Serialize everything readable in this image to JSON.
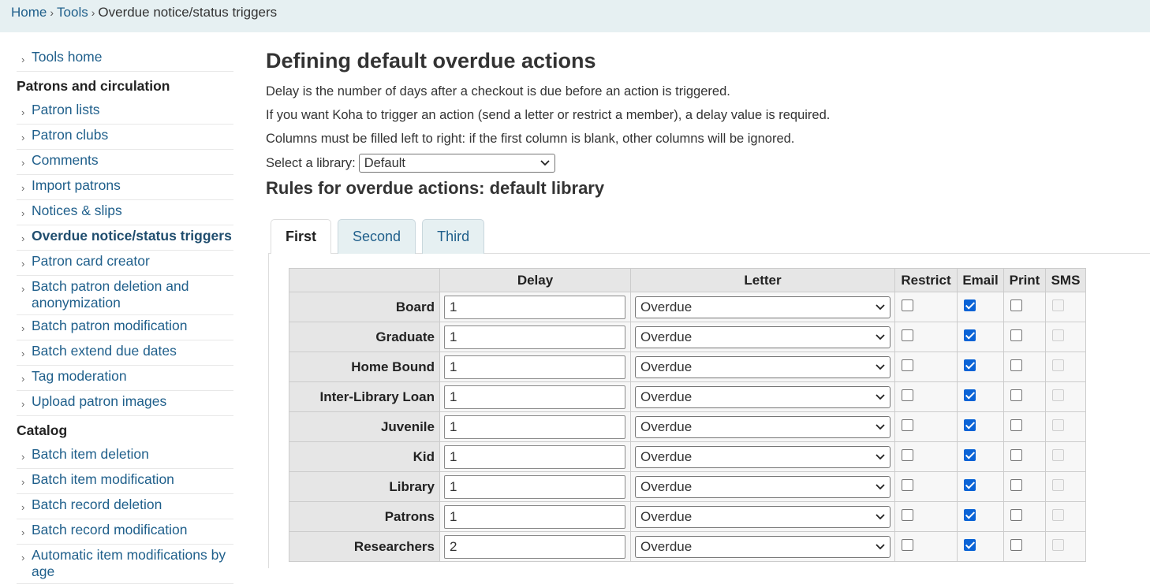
{
  "breadcrumb": {
    "home": "Home",
    "tools": "Tools",
    "current": "Overdue notice/status triggers",
    "sep": "›"
  },
  "sidebar": {
    "tools_home": "Tools home",
    "section1": "Patrons and circulation",
    "items1": [
      {
        "label": "Patron lists",
        "current": false
      },
      {
        "label": "Patron clubs",
        "current": false
      },
      {
        "label": "Comments",
        "current": false
      },
      {
        "label": "Import patrons",
        "current": false
      },
      {
        "label": "Notices & slips",
        "current": false
      },
      {
        "label": "Overdue notice/status triggers",
        "current": true
      },
      {
        "label": "Patron card creator",
        "current": false
      },
      {
        "label": "Batch patron deletion and anonymization",
        "current": false
      },
      {
        "label": "Batch patron modification",
        "current": false
      },
      {
        "label": "Batch extend due dates",
        "current": false
      },
      {
        "label": "Tag moderation",
        "current": false
      },
      {
        "label": "Upload patron images",
        "current": false
      }
    ],
    "section2": "Catalog",
    "items2": [
      {
        "label": "Batch item deletion"
      },
      {
        "label": "Batch item modification"
      },
      {
        "label": "Batch record deletion"
      },
      {
        "label": "Batch record modification"
      },
      {
        "label": "Automatic item modifications by age"
      }
    ]
  },
  "main": {
    "title": "Defining default overdue actions",
    "para1": "Delay is the number of days after a checkout is due before an action is triggered.",
    "para2": "If you want Koha to trigger an action (send a letter or restrict a member), a delay value is required.",
    "para3": "Columns must be filled left to right: if the first column is blank, other columns will be ignored.",
    "select_label": "Select a library:",
    "select_value": "Default",
    "subtitle": "Rules for overdue actions: default library"
  },
  "tabs": [
    "First",
    "Second",
    "Third"
  ],
  "table": {
    "headers": [
      "",
      "Delay",
      "Letter",
      "Restrict",
      "Email",
      "Print",
      "SMS"
    ],
    "rows": [
      {
        "category": "Board",
        "delay": "1",
        "letter": "Overdue"
      },
      {
        "category": "Graduate",
        "delay": "1",
        "letter": "Overdue"
      },
      {
        "category": "Home Bound",
        "delay": "1",
        "letter": "Overdue"
      },
      {
        "category": "Inter-Library Loan",
        "delay": "1",
        "letter": "Overdue"
      },
      {
        "category": "Juvenile",
        "delay": "1",
        "letter": "Overdue"
      },
      {
        "category": "Kid",
        "delay": "1",
        "letter": "Overdue"
      },
      {
        "category": "Library",
        "delay": "1",
        "letter": "Overdue"
      },
      {
        "category": "Patrons",
        "delay": "1",
        "letter": "Overdue"
      },
      {
        "category": "Researchers",
        "delay": "2",
        "letter": "Overdue"
      }
    ],
    "restrict_checked": false,
    "email_checked": true,
    "print_checked": false,
    "sms_disabled": true
  },
  "colors": {
    "link": "#1f5f8b",
    "breadcrumb_bg": "#e6f0f2",
    "checkbox_checked": "#0a63d6"
  }
}
